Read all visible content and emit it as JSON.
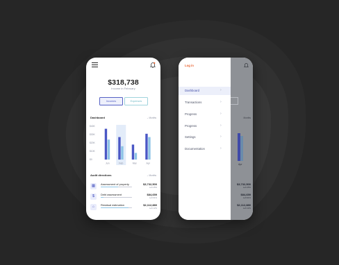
{
  "dashboard_screen": {
    "balance": "$318,738",
    "balance_caption": "Income in February",
    "buttons": {
      "income": "Incomes",
      "expense": "Expenses"
    },
    "dashboard": {
      "title": "Dashboard",
      "period": "Months"
    },
    "audit": {
      "title": "Audit directions",
      "period": "Months"
    },
    "audit_items": [
      {
        "icon": "bank-icon",
        "name": "Assessment of property",
        "amount": "$3,732,500",
        "left": "Left 45%",
        "progress": 0.55
      },
      {
        "icon": "dollar-icon",
        "name": "Debt assessment",
        "amount": "$84,659",
        "left": "Left 91%",
        "progress": 0.09
      },
      {
        "icon": "store-icon",
        "name": "Residual estimation",
        "amount": "$2,112,880",
        "left": "Left 12%",
        "progress": 0.88
      }
    ]
  },
  "menu_screen": {
    "login": "Log in",
    "items": [
      {
        "label": "Dashboard",
        "active": true
      },
      {
        "label": "Transactions",
        "active": false
      },
      {
        "label": "Progress",
        "active": false
      },
      {
        "label": "Progress",
        "active": false
      },
      {
        "label": "Settings",
        "active": false
      },
      {
        "label": "Documentation",
        "active": false
      }
    ],
    "dimmed": {
      "months": "Months",
      "apr": "Apr",
      "amounts": [
        {
          "amount": "$3,732,500",
          "left": "Left 45%"
        },
        {
          "amount": "$84,659",
          "left": "Left 91%"
        },
        {
          "amount": "$2,112,880",
          "left": "Left 12%"
        }
      ]
    }
  },
  "chart_data": {
    "type": "bar",
    "categories": [
      "Jun",
      "Feb",
      "Mar",
      "Apr"
    ],
    "ytick_labels": [
      "$40K",
      "$30K",
      "$20K",
      "$10K",
      "$0"
    ],
    "ylim": [
      0,
      40
    ],
    "series": [
      {
        "values": [
          37,
          27,
          18,
          31
        ],
        "color": "#4a57c5"
      },
      {
        "values": [
          24,
          16,
          8,
          27
        ],
        "color": "#8dc4e6"
      }
    ],
    "highlight_category": "Feb"
  },
  "colors": {
    "accent": "#4a57c5",
    "secondary": "#8dc4e6",
    "login": "#e8602c",
    "background": "#262626"
  }
}
